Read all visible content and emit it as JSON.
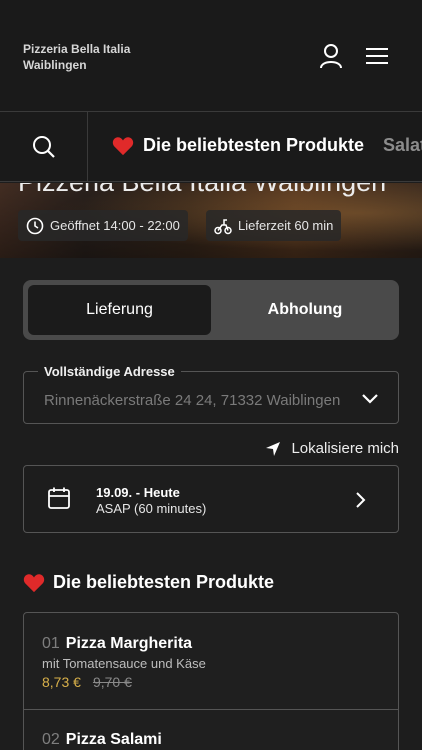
{
  "header": {
    "brand_line1": "Pizzeria Bella Italia",
    "brand_line2": "Waiblingen",
    "icons": [
      "user-icon",
      "menu-icon"
    ]
  },
  "categories": {
    "search_icon": "search-icon",
    "tabs": [
      {
        "label": "Die beliebtesten Produkte",
        "active": true,
        "icon": "heart-icon"
      },
      {
        "label": "Salat",
        "active": false
      }
    ]
  },
  "hero": {
    "title": "Pizzeria Bella Italia Waiblingen",
    "opening_hours": "Geöffnet 14:00 - 22:00",
    "delivery_time": "Lieferzeit 60 min"
  },
  "order_mode": {
    "options": [
      "Lieferung",
      "Abholung"
    ],
    "selected": "Lieferung"
  },
  "address": {
    "label": "Vollständige Adresse",
    "value": "Rinnenäckerstraße 24 24, 71332 Waiblingen"
  },
  "locate_label": "Lokalisiere mich",
  "schedule": {
    "date": "19.09. - Heute",
    "time": "ASAP (60 minutes)"
  },
  "section": {
    "title": "Die beliebtesten Produkte"
  },
  "products": [
    {
      "number": "01",
      "name": "Pizza Margherita",
      "description": "mit Tomatensauce und Käse",
      "price": "8,73 €",
      "old_price": "9,70 €"
    },
    {
      "number": "02",
      "name": "Pizza Salami",
      "description": "",
      "price": "",
      "old_price": ""
    }
  ],
  "colors": {
    "background": "#1d1d1d",
    "accent_heart": "#e02a2a",
    "sale_price": "#d8b04a"
  }
}
